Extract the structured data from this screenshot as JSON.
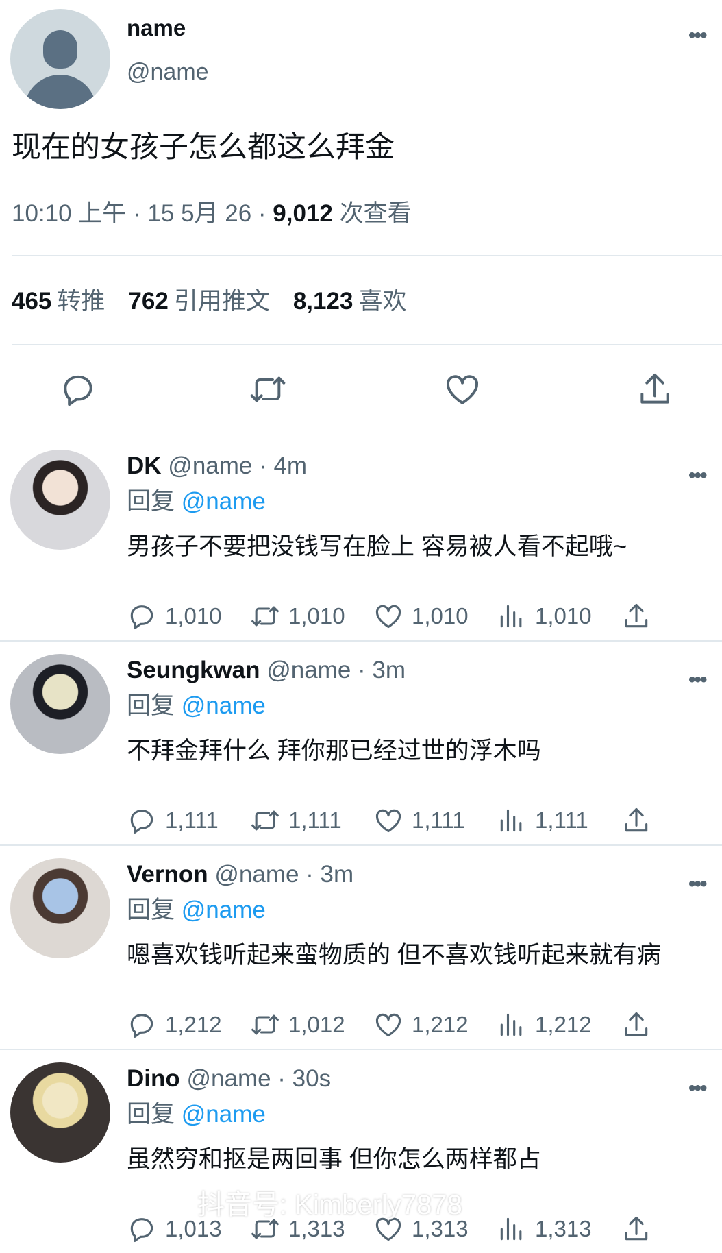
{
  "main": {
    "name": "name",
    "handle": "@name",
    "text": "现在的女孩子怎么都这么拜金",
    "time": "10:10 上午 · 15 5月 26 · ",
    "views": "9,012",
    "views_label": " 次查看",
    "retweets": "465",
    "retweets_label": "转推",
    "quotes": "762",
    "quotes_label": "引用推文",
    "likes": "8,123",
    "likes_label": "喜欢",
    "more": "•••"
  },
  "replies": [
    {
      "name": "DK",
      "handle": " @name · 4m",
      "replying": "回复 ",
      "mention": "@name",
      "text": "男孩子不要把没钱写在脸上 容易被人看不起哦~",
      "comments": "1,010",
      "retweets": "1,010",
      "likes": "1,010",
      "views": "1,010",
      "avatar_colors": [
        "#d8d8dc",
        "#2b2424",
        "#f2e2d6"
      ]
    },
    {
      "name": "Seungkwan",
      "handle": " @name · 3m",
      "replying": "回复 ",
      "mention": "@name",
      "text": "不拜金拜什么 拜你那已经过世的浮木吗",
      "comments": "1,111",
      "retweets": "1,111",
      "likes": "1,111",
      "views": "1,111",
      "avatar_colors": [
        "#b9bcc2",
        "#1d1f26",
        "#e7e3c6"
      ]
    },
    {
      "name": "Vernon",
      "handle": " @name · 3m",
      "replying": "回复 ",
      "mention": "@name",
      "text": "嗯喜欢钱听起来蛮物质的 但不喜欢钱听起来就有病",
      "comments": "1,212",
      "retweets": "1,012",
      "likes": "1,212",
      "views": "1,212",
      "avatar_colors": [
        "#ddd8d3",
        "#4b3a33",
        "#a8c4e6"
      ]
    },
    {
      "name": "Dino",
      "handle": " @name · 30s",
      "replying": "回复 ",
      "mention": "@name",
      "text": "虽然穷和抠是两回事 但你怎么两样都占",
      "comments": "1,013",
      "retweets": "1,313",
      "likes": "1,313",
      "views": "1,313",
      "avatar_colors": [
        "#3a3432",
        "#e8d9a0",
        "#f1e7c4"
      ]
    }
  ],
  "watermark": "抖音号: Kimberly7878",
  "colors": {
    "accent": "#1d9bf0",
    "muted": "#536471",
    "text": "#0f1419",
    "divider": "#e1e8ed"
  }
}
